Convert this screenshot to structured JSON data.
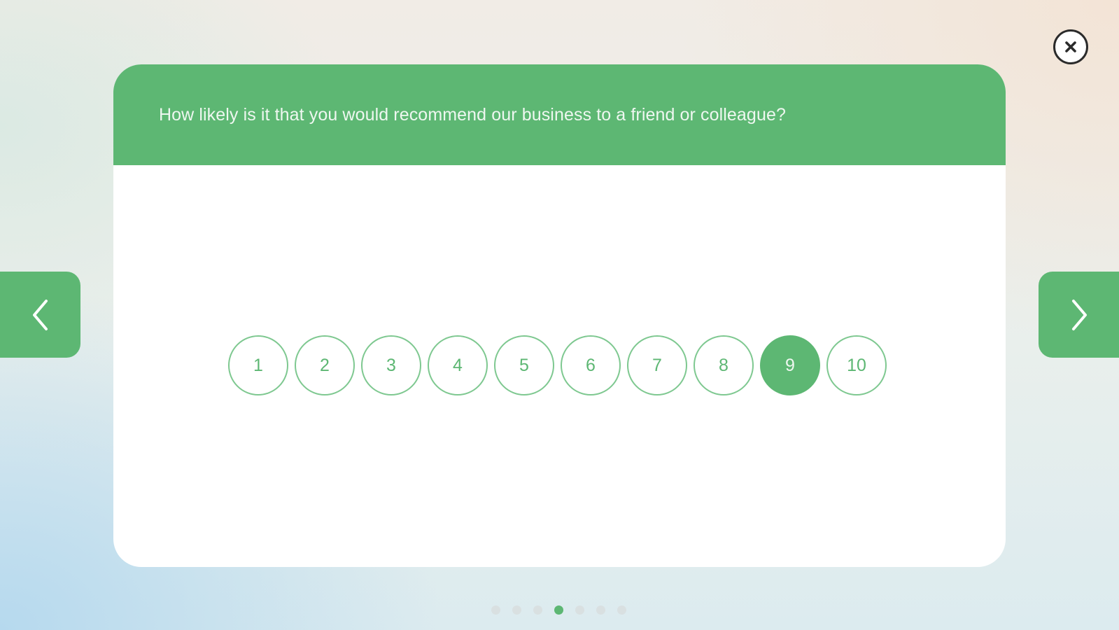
{
  "survey": {
    "question": "How likely is it that you would recommend our business to a friend or colleague?",
    "scale_options": [
      "1",
      "2",
      "3",
      "4",
      "5",
      "6",
      "7",
      "8",
      "9",
      "10"
    ],
    "selected_value": "9"
  },
  "navigation": {
    "prev_icon": "chevron-left-icon",
    "next_icon": "chevron-right-icon",
    "close_icon": "close-icon"
  },
  "pagination": {
    "total_pages": 7,
    "current_page": 4
  },
  "colors": {
    "accent": "#5db773",
    "option_border": "#7ec890",
    "header_text": "#eef7f0",
    "inactive_dot": "#d9e0e1"
  }
}
